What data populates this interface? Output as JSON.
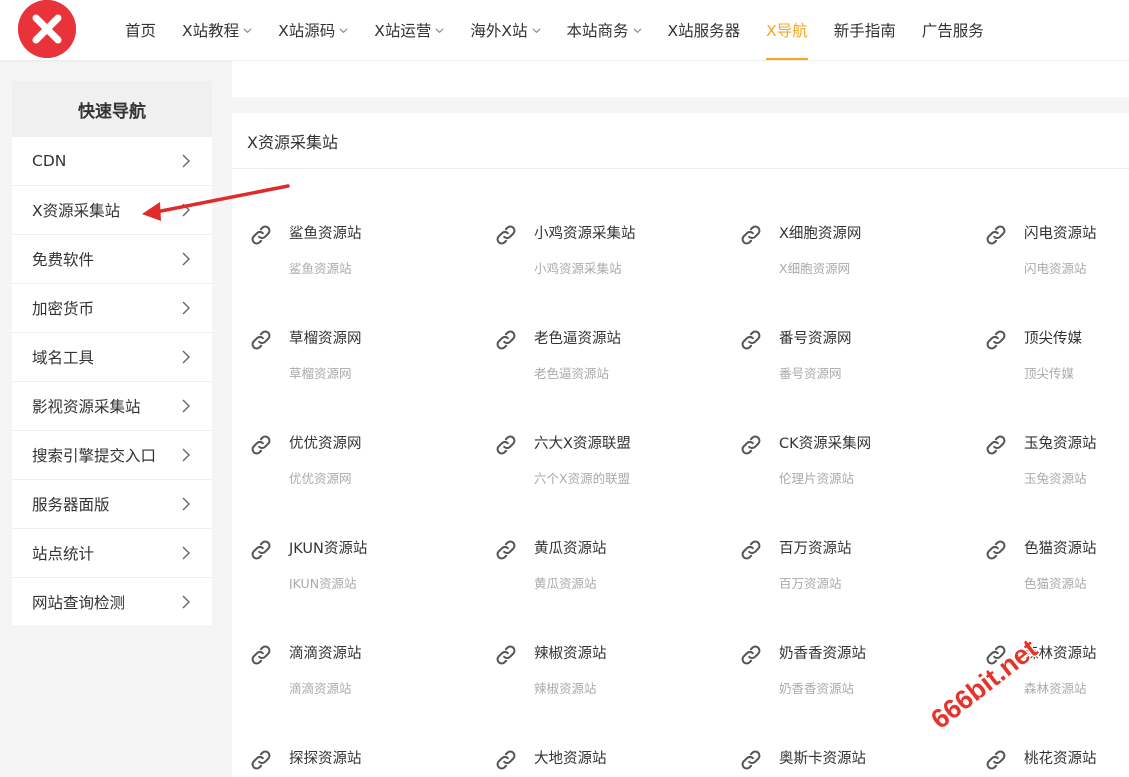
{
  "colors": {
    "accent": "#f5a623",
    "logo": "#e8333a",
    "annotation": "#e02b2b"
  },
  "nav": [
    {
      "label": "首页",
      "dropdown": false,
      "active": false
    },
    {
      "label": "X站教程",
      "dropdown": true,
      "active": false
    },
    {
      "label": "X站源码",
      "dropdown": true,
      "active": false
    },
    {
      "label": "X站运营",
      "dropdown": true,
      "active": false
    },
    {
      "label": "海外X站",
      "dropdown": true,
      "active": false
    },
    {
      "label": "本站商务",
      "dropdown": true,
      "active": false
    },
    {
      "label": "X站服务器",
      "dropdown": false,
      "active": false
    },
    {
      "label": "X导航",
      "dropdown": false,
      "active": true
    },
    {
      "label": "新手指南",
      "dropdown": false,
      "active": false
    },
    {
      "label": "广告服务",
      "dropdown": false,
      "active": false
    }
  ],
  "sidebar": {
    "title": "快速导航",
    "items": [
      {
        "label": "CDN"
      },
      {
        "label": "X资源采集站"
      },
      {
        "label": "免费软件"
      },
      {
        "label": "加密货币"
      },
      {
        "label": "域名工具"
      },
      {
        "label": "影视资源采集站"
      },
      {
        "label": "搜索引擎提交入口"
      },
      {
        "label": "服务器面版"
      },
      {
        "label": "站点统计"
      },
      {
        "label": "网站查询检测"
      }
    ]
  },
  "section": {
    "title": "X资源采集站",
    "sites": [
      {
        "name": "鲨鱼资源站",
        "desc": "鲨鱼资源站"
      },
      {
        "name": "小鸡资源采集站",
        "desc": "小鸡资源采集站"
      },
      {
        "name": "X细胞资源网",
        "desc": "X细胞资源网"
      },
      {
        "name": "闪电资源站",
        "desc": "闪电资源站"
      },
      {
        "name": "草榴资源网",
        "desc": "草榴资源网"
      },
      {
        "name": "老色逼资源站",
        "desc": "老色逼资源站"
      },
      {
        "name": "番号资源网",
        "desc": "番号资源网"
      },
      {
        "name": "顶尖传媒",
        "desc": "顶尖传媒"
      },
      {
        "name": "优优资源网",
        "desc": "优优资源网"
      },
      {
        "name": "六大X资源联盟",
        "desc": "六个X资源的联盟"
      },
      {
        "name": "CK资源采集网",
        "desc": "伦理片资源站"
      },
      {
        "name": "玉兔资源站",
        "desc": "玉兔资源站"
      },
      {
        "name": "JKUN资源站",
        "desc": "JKUN资源站"
      },
      {
        "name": "黄瓜资源站",
        "desc": "黄瓜资源站"
      },
      {
        "name": "百万资源站",
        "desc": "百万资源站"
      },
      {
        "name": "色猫资源站",
        "desc": "色猫资源站"
      },
      {
        "name": "滴滴资源站",
        "desc": "滴滴资源站"
      },
      {
        "name": "辣椒资源站",
        "desc": "辣椒资源站"
      },
      {
        "name": "奶香香资源站",
        "desc": "奶香香资源站"
      },
      {
        "name": "森林资源站",
        "desc": "森林资源站"
      },
      {
        "name": "探探资源站",
        "desc": ""
      },
      {
        "name": "大地资源站",
        "desc": ""
      },
      {
        "name": "奥斯卡资源站",
        "desc": ""
      },
      {
        "name": "桃花资源站",
        "desc": ""
      }
    ]
  },
  "watermark": {
    "text": "666bit.net"
  }
}
